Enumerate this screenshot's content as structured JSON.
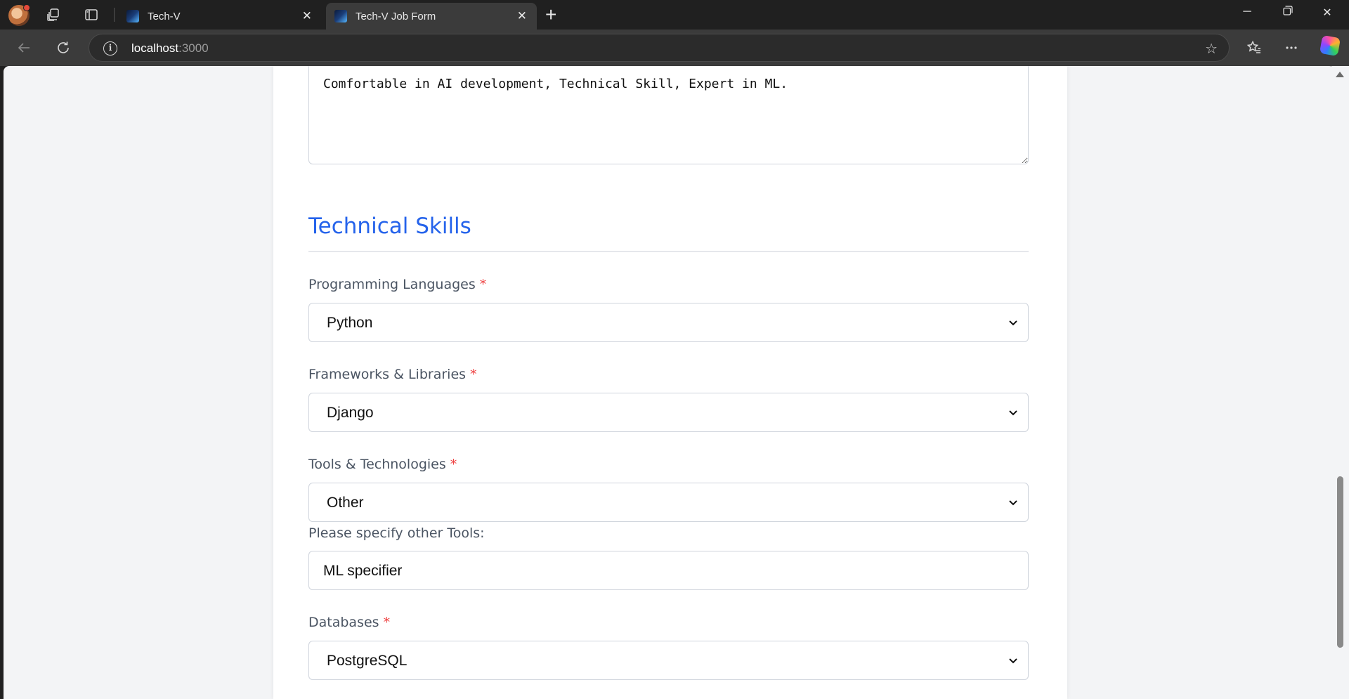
{
  "browser": {
    "tabs": [
      {
        "title": "Tech-V",
        "active": false
      },
      {
        "title": "Tech-V Job Form",
        "active": true
      }
    ],
    "url_host": "localhost",
    "url_port": ":3000"
  },
  "form": {
    "description_value": "Comfortable in AI development, Technical Skill, Expert in ML.",
    "section_title": "Technical Skills",
    "required_marker": "*",
    "fields": {
      "programming_languages": {
        "label": "Programming Languages",
        "value": "Python"
      },
      "frameworks": {
        "label": "Frameworks & Libraries",
        "value": "Django"
      },
      "tools": {
        "label": "Tools & Technologies",
        "value": "Other"
      },
      "other_tools": {
        "label": "Please specify other Tools:",
        "value": "ML specifier"
      },
      "databases": {
        "label": "Databases",
        "value": "PostgreSQL"
      }
    }
  },
  "colors": {
    "accent": "#2563eb",
    "required": "#ef4444",
    "label": "#4b5563"
  }
}
